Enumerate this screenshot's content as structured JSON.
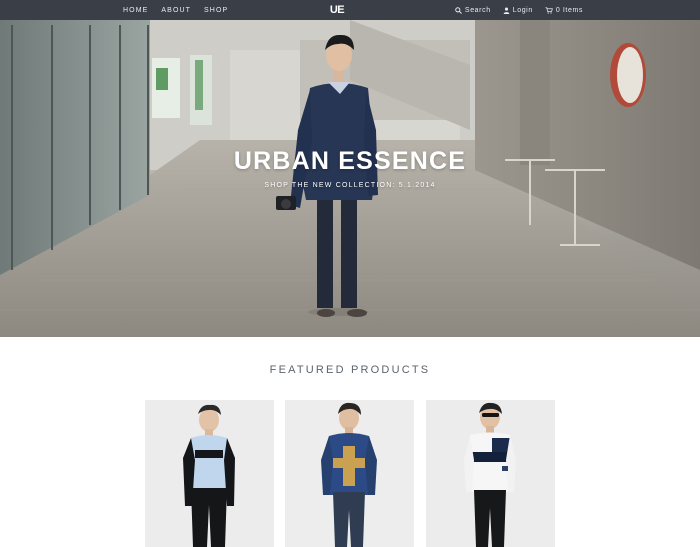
{
  "nav": {
    "links": [
      "HOME",
      "ABOUT",
      "SHOP"
    ],
    "logo": "UE",
    "search_label": "Search",
    "login_label": "Login",
    "cart_label": "0 Items"
  },
  "hero": {
    "title": "URBAN ESSENCE",
    "subtitle": "SHOP THE NEW COLLECTION: 5.1.2014"
  },
  "featured": {
    "heading": "FEATURED PRODUCTS",
    "products": [
      {
        "image": "model in light blue shirt with black sleeves"
      },
      {
        "image": "model in navy jacket with yellow cross"
      },
      {
        "image": "model in white and navy colorblock sweater"
      }
    ]
  },
  "colors": {
    "navbar": "#3a3f47",
    "nav_text": "#e9ecef",
    "heading": "#5b636b",
    "product_bg": "#eeeeee"
  }
}
